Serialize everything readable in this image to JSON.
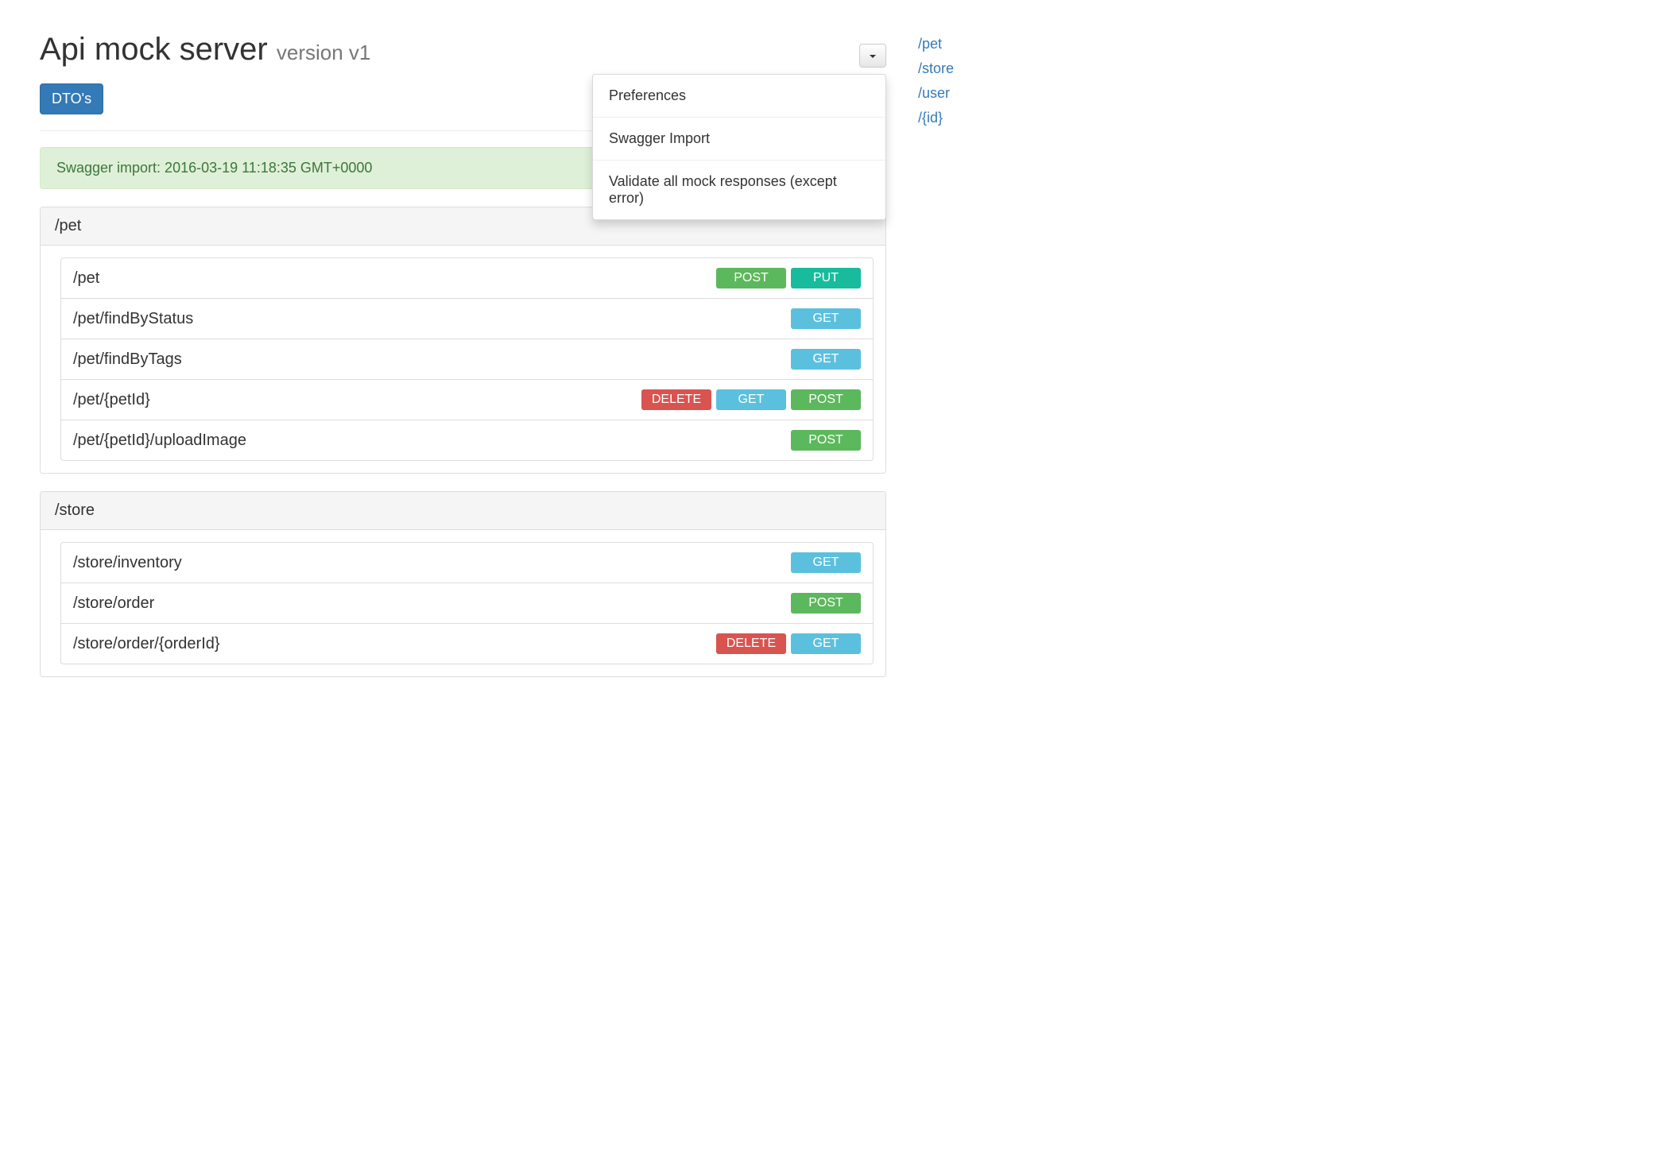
{
  "header": {
    "title": "Api mock server",
    "version_label": "version v1"
  },
  "dropdown": {
    "items": [
      "Preferences",
      "Swagger Import",
      "Validate all mock responses (except error)"
    ]
  },
  "dtos_button_label": "DTO's",
  "alert_text": "Swagger import: 2016-03-19 11:18:35 GMT+0000",
  "sidebar_links": [
    "/pet",
    "/store",
    "/user",
    "/{id}"
  ],
  "groups": [
    {
      "name": "/pet",
      "routes": [
        {
          "path": "/pet",
          "methods": [
            "POST",
            "PUT"
          ]
        },
        {
          "path": "/pet/findByStatus",
          "methods": [
            "GET"
          ]
        },
        {
          "path": "/pet/findByTags",
          "methods": [
            "GET"
          ]
        },
        {
          "path": "/pet/{petId}",
          "methods": [
            "DELETE",
            "GET",
            "POST"
          ]
        },
        {
          "path": "/pet/{petId}/uploadImage",
          "methods": [
            "POST"
          ]
        }
      ]
    },
    {
      "name": "/store",
      "routes": [
        {
          "path": "/store/inventory",
          "methods": [
            "GET"
          ]
        },
        {
          "path": "/store/order",
          "methods": [
            "POST"
          ]
        },
        {
          "path": "/store/order/{orderId}",
          "methods": [
            "DELETE",
            "GET"
          ]
        }
      ]
    }
  ]
}
